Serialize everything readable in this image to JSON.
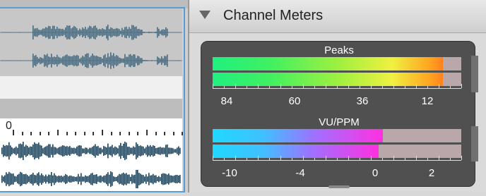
{
  "panel": {
    "title": "Channel Meters",
    "collapse_icon": "disclosure-triangle-down-icon"
  },
  "peaks": {
    "label": "Peaks",
    "levels": [
      0.926,
      0.926
    ],
    "scale": [
      "84",
      "60",
      "36",
      "12"
    ]
  },
  "vu": {
    "label": "VU/PPM",
    "levels": [
      0.685,
      0.668
    ],
    "scale": [
      "-10",
      "-4",
      "0",
      "2"
    ]
  },
  "timeline": {
    "ruler_start": "0"
  },
  "colors": {
    "selection_border": "#5b9bd5",
    "meter_background": "#505050",
    "waveform_dark": "#1f3f55",
    "waveform_light": "#4d6b7d"
  }
}
